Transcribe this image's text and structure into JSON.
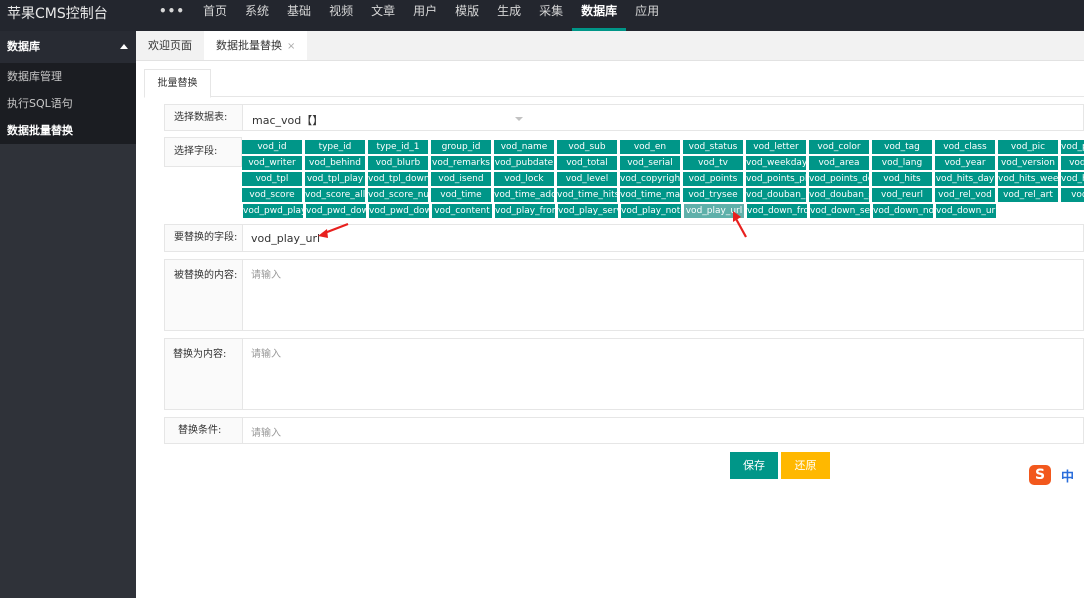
{
  "app": {
    "title": "苹果CMS控制台"
  },
  "topnav": [
    {
      "label": "•••"
    },
    {
      "label": "首页"
    },
    {
      "label": "系统"
    },
    {
      "label": "基础"
    },
    {
      "label": "视频"
    },
    {
      "label": "文章"
    },
    {
      "label": "用户"
    },
    {
      "label": "模版"
    },
    {
      "label": "生成"
    },
    {
      "label": "采集"
    },
    {
      "label": "数据库"
    },
    {
      "label": "应用"
    }
  ],
  "topnav_active": "数据库",
  "sidebar": {
    "header": "数据库",
    "items": [
      {
        "label": "数据库管理"
      },
      {
        "label": "执行SQL语句"
      },
      {
        "label": "数据批量替换"
      }
    ]
  },
  "tabs": [
    {
      "label": "欢迎页面"
    },
    {
      "label": "数据批量替换",
      "close": "×"
    }
  ],
  "subtab": "批量替换",
  "form": {
    "table_label": "选择数据表:",
    "table_value": "mac_vod【】",
    "fields_label": "选择字段:",
    "fields": [
      [
        "vod_id",
        "type_id",
        "type_id_1",
        "group_id",
        "vod_name",
        "vod_sub",
        "vod_en",
        "vod_status",
        "vod_letter",
        "vod_color",
        "vod_tag",
        "vod_class",
        "vod_pic",
        "vod_pic_thumb"
      ],
      [
        "vod_writer",
        "vod_behind",
        "vod_blurb",
        "vod_remarks",
        "vod_pubdate",
        "vod_total",
        "vod_serial",
        "vod_tv",
        "vod_weekday",
        "vod_area",
        "vod_lang",
        "vod_year",
        "vod_version",
        "vod_state"
      ],
      [
        "vod_tpl",
        "vod_tpl_play",
        "vod_tpl_down",
        "vod_isend",
        "vod_lock",
        "vod_level",
        "vod_copyright",
        "vod_points",
        "vod_points_play",
        "vod_points_down",
        "vod_hits",
        "vod_hits_day",
        "vod_hits_week",
        "vod_hits_month"
      ],
      [
        "vod_score",
        "vod_score_all",
        "vod_score_num",
        "vod_time",
        "vod_time_add",
        "vod_time_hits",
        "vod_time_make",
        "vod_trysee",
        "vod_douban_id",
        "vod_douban_score",
        "vod_reurl",
        "vod_rel_vod",
        "vod_rel_art",
        "vod_pwd"
      ],
      [
        "vod_pwd_play",
        "vod_pwd_down",
        "vod_pwd_down_url",
        "vod_content",
        "vod_play_from",
        "vod_play_server",
        "vod_play_note",
        "vod_play_url",
        "vod_down_from",
        "vod_down_server",
        "vod_down_note",
        "vod_down_url"
      ]
    ],
    "selected_field": "vod_play_url",
    "target_label": "要替换的字段:",
    "target_value": "vod_play_url",
    "find_label": "被替换的内容:",
    "find_placeholder": "请输入",
    "replace_label": "替换为内容:",
    "replace_placeholder": "请输入",
    "where_label": "替换条件:",
    "where_placeholder": "请输入"
  },
  "buttons": {
    "save": "保存",
    "reset": "还原"
  },
  "ime": {
    "s": "S",
    "lang": "中"
  },
  "colors": {
    "accent": "#009688",
    "warn": "#ffb800",
    "topbar": "#23262e",
    "sidebar": "#2f3239"
  }
}
